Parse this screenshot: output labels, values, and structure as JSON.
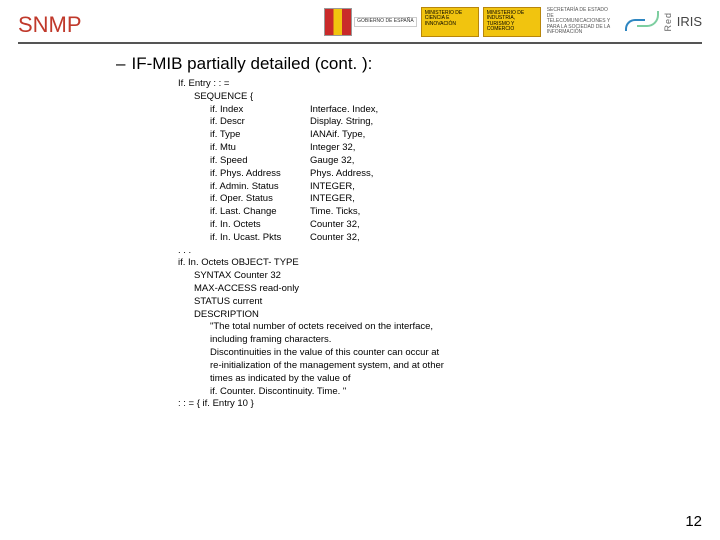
{
  "header": {
    "title": "SNMP",
    "gov_label": "GOBIERNO DE ESPAÑA",
    "ministerio1": "MINISTERIO DE CIENCIA E INNOVACIÓN",
    "ministerio2": "MINISTERIO DE INDUSTRIA, TURISMO Y COMERCIO",
    "setsi": "SECRETARÍA DE ESTADO DE TELECOMUNICACIONES Y PARA LA SOCIEDAD DE LA INFORMACIÓN",
    "iris_small": "Red",
    "iris_big": "IRIS"
  },
  "subheading": {
    "dash": "–",
    "text": "IF-MIB partially detailed (cont. ):"
  },
  "mib": {
    "line1": "If. Entry : : =",
    "line2": "SEQUENCE {",
    "sequence": [
      {
        "name": "if. Index",
        "type": "Interface. Index,"
      },
      {
        "name": "if. Descr",
        "type": "Display. String,"
      },
      {
        "name": "if. Type",
        "type": "IANAif. Type,"
      },
      {
        "name": "if. Mtu",
        "type": "Integer 32,"
      },
      {
        "name": "if. Speed",
        "type": "Gauge 32,"
      },
      {
        "name": "if. Phys. Address",
        "type": "Phys. Address,"
      },
      {
        "name": "if. Admin. Status",
        "type": "INTEGER,"
      },
      {
        "name": "if. Oper. Status",
        "type": "INTEGER,"
      },
      {
        "name": "if. Last. Change",
        "type": "Time. Ticks,"
      },
      {
        "name": "if. In. Octets",
        "type": "Counter 32,"
      },
      {
        "name": "if. In. Ucast. Pkts",
        "type": "Counter 32,"
      }
    ],
    "ellipsis": ". . .",
    "obj_line": "if. In. Octets  OBJECT- TYPE",
    "syntax": "SYNTAX      Counter 32",
    "maxaccess": "MAX-ACCESS  read-only",
    "status": "STATUS      current",
    "desc_key": "DESCRIPTION",
    "desc": [
      "\"The total number of octets received on the interface,",
      "including framing characters.",
      "Discontinuities in the value of this counter can occur at",
      "re-initialization of the management system, and at other",
      "times as indicated by the value of",
      "if. Counter. Discontinuity. Time. \""
    ],
    "assign": ": : =  { if. Entry 10 }"
  },
  "page_number": "12"
}
